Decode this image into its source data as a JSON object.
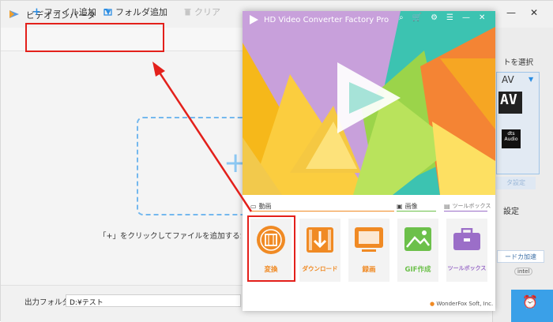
{
  "main_window": {
    "title": "ビデオコンバータ",
    "toolbar": {
      "add_file": "ファイル追加",
      "add_folder": "フォルダ追加",
      "clear": "クリア"
    },
    "drop_hint": "「+」をクリックしてファイルを追加するか、ま",
    "output": {
      "label": "出力フォルダ：",
      "path": "D:¥テスト"
    },
    "right_panel": {
      "format_select": "トを選択",
      "format_value": "AV",
      "format_badge": "AV",
      "dts_badge": "dts Audio",
      "param_button": "タ設定",
      "settings_label": "設定",
      "hw_accel": "ードカ加速",
      "intel_badge": "intel"
    }
  },
  "launcher": {
    "title": "HD Video Converter Factory Pro",
    "sections": {
      "video": "動画",
      "image": "画像",
      "toolbox": "ツールボックス"
    },
    "tiles": [
      {
        "label": "変換",
        "color": "#f08a24"
      },
      {
        "label": "ダウンロード",
        "color": "#f08a24"
      },
      {
        "label": "録画",
        "color": "#f08a24"
      },
      {
        "label": "GIF作成",
        "color": "#6cc04a"
      },
      {
        "label": "ツールボックス",
        "color": "#9b6ec8"
      }
    ],
    "footer": "WonderFox Soft, Inc."
  },
  "colors": {
    "annotation_red": "#e3201b",
    "accent_blue": "#2b8de3",
    "orange": "#f08a24",
    "green": "#6cc04a",
    "purple": "#9b6ec8"
  }
}
